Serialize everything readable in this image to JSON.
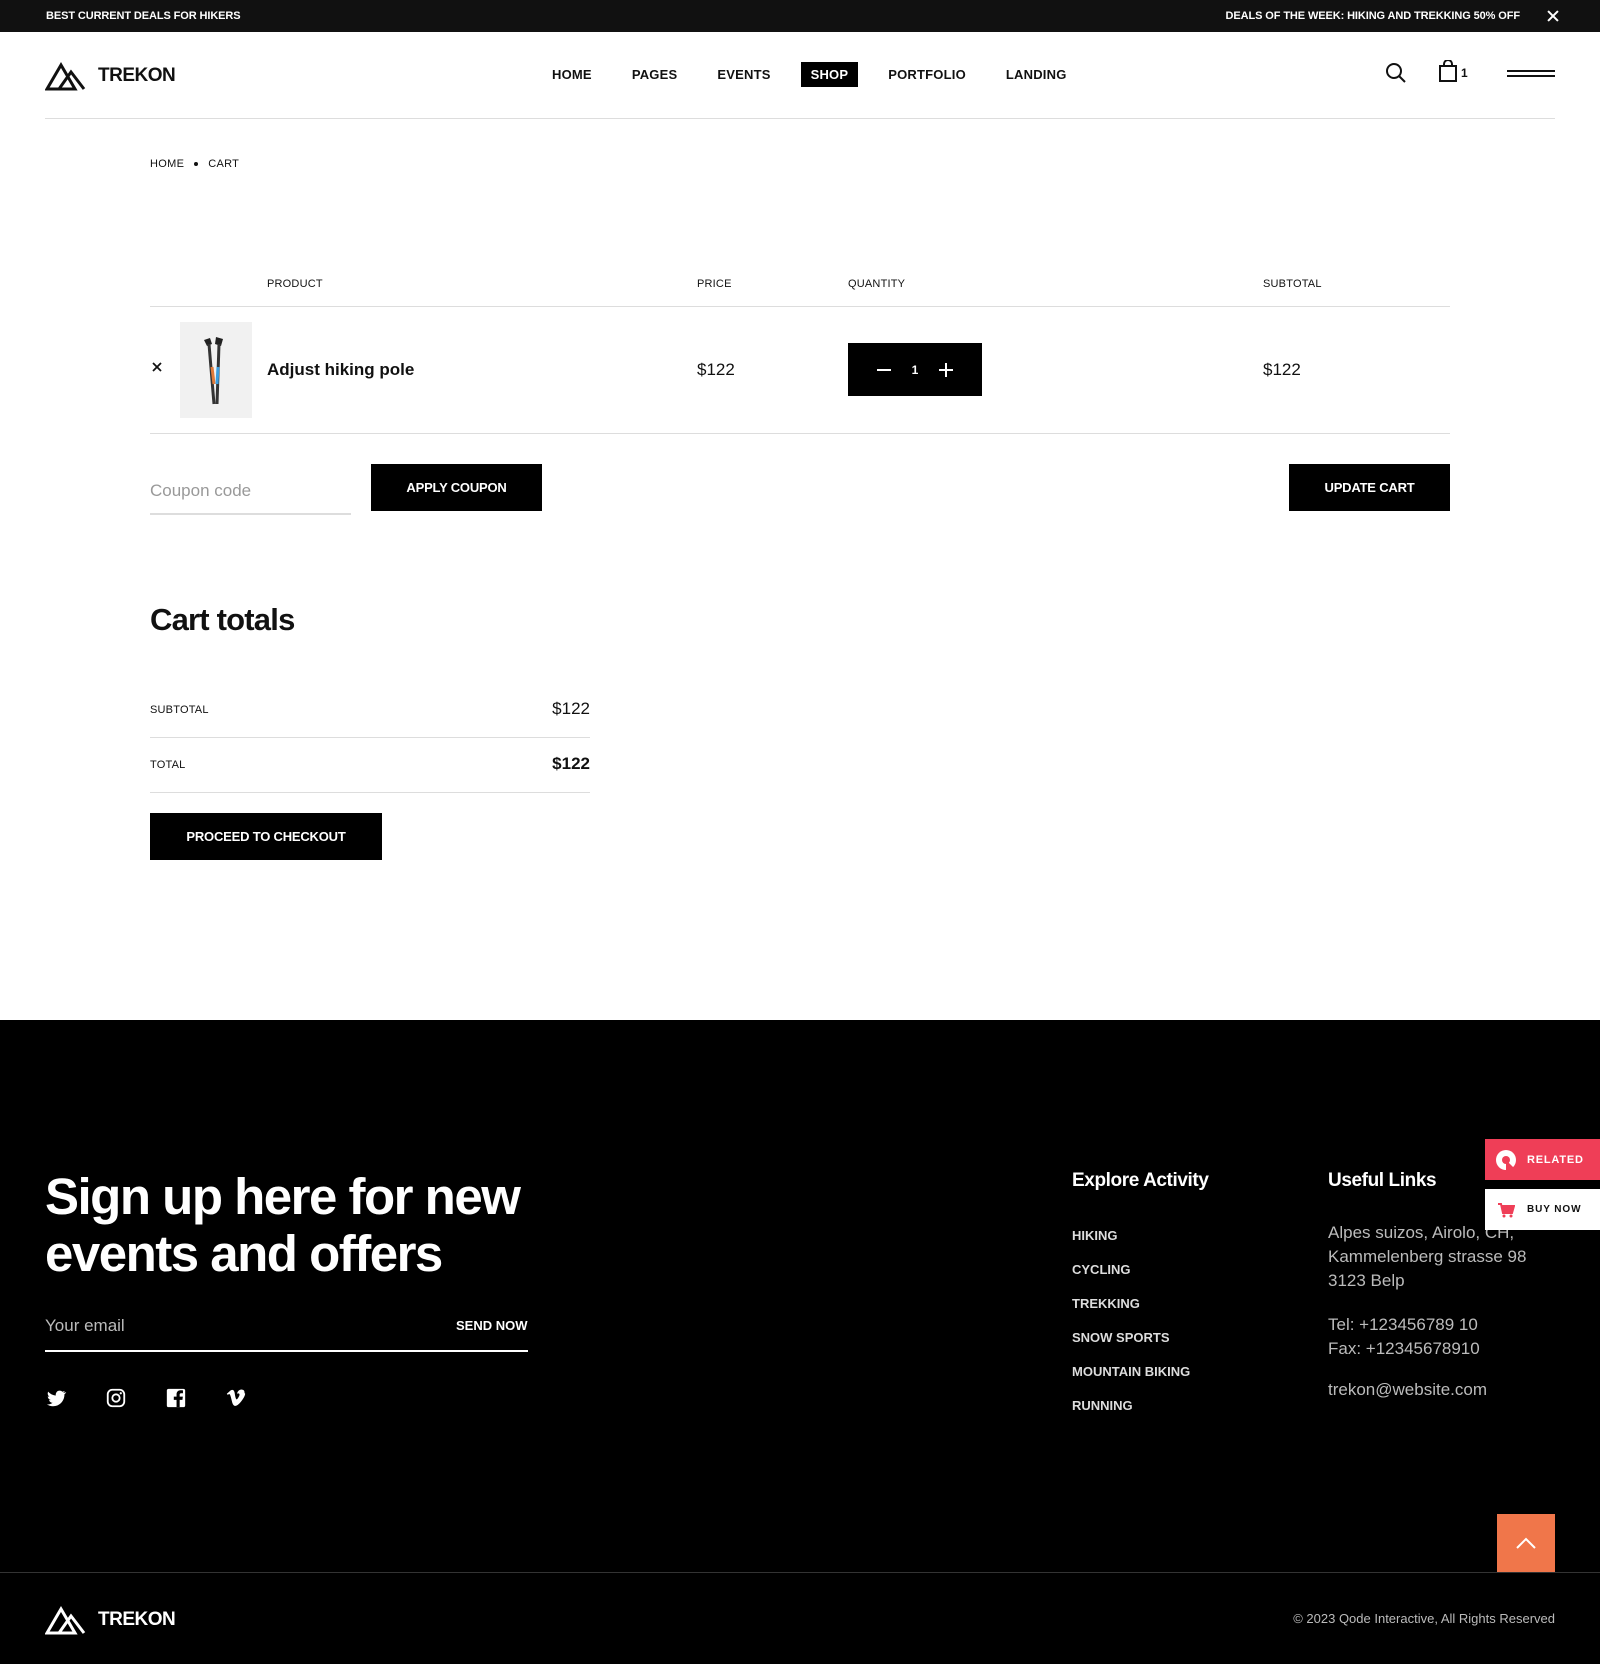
{
  "topbar": {
    "left_text": "BEST CURRENT DEALS FOR HIKERS",
    "right_text": "DEALS OF THE WEEK: HIKING AND TREKKING 50% OFF"
  },
  "header": {
    "logo_text": "TREKON",
    "nav": [
      "HOME",
      "PAGES",
      "EVENTS",
      "SHOP",
      "PORTFOLIO",
      "LANDING"
    ],
    "active_nav": "SHOP",
    "cart_count": "1"
  },
  "breadcrumb": [
    "HOME",
    "CART"
  ],
  "cart": {
    "headers": {
      "product": "PRODUCT",
      "price": "PRICE",
      "quantity": "QUANTITY",
      "subtotal": "SUBTOTAL"
    },
    "items": [
      {
        "name": "Adjust hiking pole",
        "price": "$122",
        "quantity": "1",
        "subtotal": "$122"
      }
    ],
    "coupon_placeholder": "Coupon code",
    "apply_coupon": "APPLY COUPON",
    "update_cart": "UPDATE CART"
  },
  "totals": {
    "title": "Cart totals",
    "subtotal_label": "SUBTOTAL",
    "subtotal_value": "$122",
    "total_label": "TOTAL",
    "total_value": "$122",
    "checkout": "PROCEED TO CHECKOUT"
  },
  "footer": {
    "signup_title": "Sign up here for new events and offers",
    "email_placeholder": "Your email",
    "send_now": "SEND NOW",
    "social_icons": [
      "twitter-icon",
      "instagram-icon",
      "facebook-icon",
      "vimeo-icon"
    ],
    "explore_title": "Explore Activity",
    "activities": [
      "HIKING",
      "CYCLING",
      "TREKKING",
      "SNOW SPORTS",
      "MOUNTAIN BIKING",
      "RUNNING"
    ],
    "useful_title": "Useful Links",
    "address_lines": [
      "Alpes suizos, Airolo, CH,",
      "Kammelenberg strasse 98",
      "3123 Belp"
    ],
    "tel": "Tel: +123456789 10",
    "fax": "Fax: +12345678910",
    "email": "trekon@website.com",
    "logo_text": "TREKON",
    "copyright": "© 2023 Qode Interactive, All Rights Reserved"
  },
  "floating": {
    "related": "RELATED",
    "buy_now": "BUY NOW"
  },
  "colors": {
    "accent_orange": "#f0764a",
    "related_red": "#ef3e57",
    "black": "#000000"
  }
}
